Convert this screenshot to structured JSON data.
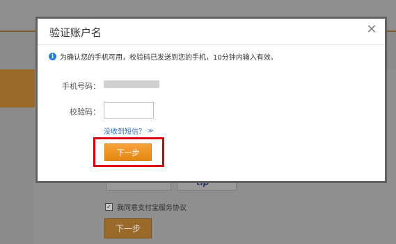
{
  "modal": {
    "title": "验证账户名",
    "close_symbol": "✕",
    "info_icon_glyph": "i",
    "info_text": "为确认您的手机可用，校验码已发送到您的手机，10分钟内输入有效。",
    "phone_label": "手机号码：",
    "code_label": "校验码：",
    "code_value": "",
    "no_sms_link": "没收到短信？",
    "no_sms_chevron": "≫",
    "next_label": "下一步"
  },
  "background": {
    "box_text": "tip",
    "agree_check": "✓",
    "agree_text": "我同意支付宝服务协议",
    "next_label": "下一步"
  },
  "colors": {
    "accent_orange": "#f39a26",
    "highlight_red": "#d6000f",
    "link_blue": "#2a6fb5"
  }
}
